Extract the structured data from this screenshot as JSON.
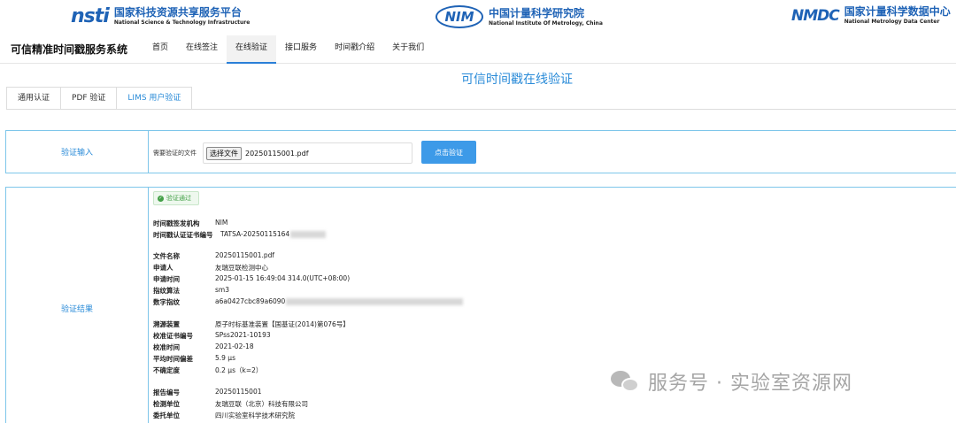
{
  "logos": [
    {
      "mark": "nsti",
      "cn": "国家科技资源共享服务平台",
      "en": "National Science & Technology Infrastructure"
    },
    {
      "mark": "NIM",
      "cn": "中国计量科学研究院",
      "en": "National Institute Of Metrology, China"
    },
    {
      "mark": "NMDC",
      "cn": "国家计量科学数据中心",
      "en": "National Metrology Data Center"
    }
  ],
  "nav": {
    "site_title": "可信精准时间戳服务系统",
    "items": [
      "首页",
      "在线签注",
      "在线验证",
      "接口服务",
      "时间戳介绍",
      "关于我们"
    ],
    "active": "在线验证"
  },
  "page_title": "可信时间戳在线验证",
  "tabs": [
    "通用认证",
    "PDF 验证",
    "LIMS 用户验证"
  ],
  "active_tab": "LIMS 用户验证",
  "input_section": {
    "label": "验证输入",
    "file_label": "需要验证的文件",
    "choose_button": "选择文件",
    "file_name": "20250115001.pdf",
    "verify_button": "点击验证"
  },
  "result_section": {
    "label": "验证结果",
    "status": "验证通过",
    "fields": [
      {
        "k": "时间戳签发机构",
        "v": "NIM"
      },
      {
        "k": "时间戳认证证书编号",
        "v": "TATSA-20250115164"
      },
      {
        "k": "文件名称",
        "v": "20250115001.pdf"
      },
      {
        "k": "申请人",
        "v": "友瑞豆联检测中心"
      },
      {
        "k": "申请时间",
        "v": "2025-01-15 16:49:04 314.0(UTC+08:00)"
      },
      {
        "k": "指纹算法",
        "v": "sm3"
      },
      {
        "k": "数字指纹",
        "v": "a6a0427cbc89a6090"
      },
      {
        "k": "溯源装置",
        "v": "原子时标基准装置【国基证(2014)第076号】"
      },
      {
        "k": "校准证书编号",
        "v": "SPss2021-10193"
      },
      {
        "k": "校准时间",
        "v": "2021-02-18"
      },
      {
        "k": "平均时间偏差",
        "v": "5.9 μs"
      },
      {
        "k": "不确定度",
        "v": "0.2 μs（k=2）"
      },
      {
        "k": "报告编号",
        "v": "20250115001"
      },
      {
        "k": "检测单位",
        "v": "友瑞豆联（北京）科技有限公司"
      },
      {
        "k": "委托单位",
        "v": "四川实验室科学技术研究院"
      }
    ]
  },
  "watermark": "服务号 · 实验室资源网"
}
